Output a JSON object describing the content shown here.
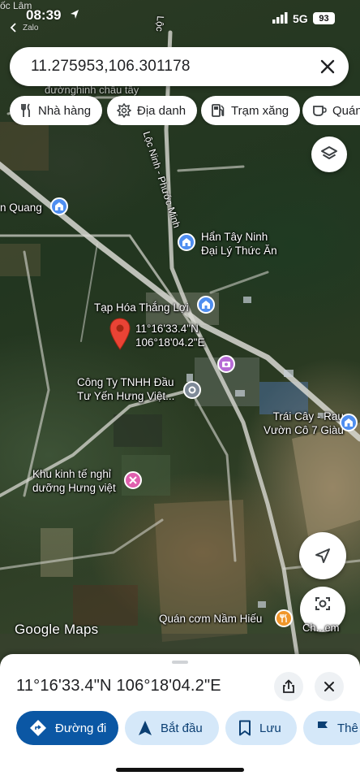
{
  "status_bar": {
    "carrier": "Zalo",
    "time": "08:39",
    "network": "5G",
    "battery": "93",
    "top_left_label": "ốc Lâm"
  },
  "search": {
    "query": "11.275953,106.301178"
  },
  "chips": [
    {
      "label": "Nhà hàng",
      "icon": "restaurant-icon"
    },
    {
      "label": "Địa danh",
      "icon": "landmark-icon"
    },
    {
      "label": "Trạm xăng",
      "icon": "gas-station-icon"
    },
    {
      "label": "Quán",
      "icon": "coffee-icon"
    }
  ],
  "map": {
    "faded_label": "đườnghinh châu tây",
    "road_name": "Lộc Ninh - Phước Minh",
    "road_name_top": "Lộc",
    "places": {
      "quang": "n Quang",
      "han_tay_ninh_1": "Hẩn Tây Ninh",
      "han_tay_ninh_2": "Đại Lý Thức Ăn",
      "tap_hoa": "Tạp Hóa Thắng Lợi",
      "pin_coord_1": "11°16'33.4\"N",
      "pin_coord_2": "106°18'04.2\"E",
      "cong_ty_1": "Công Ty TNHH Đầu",
      "cong_ty_2": "Tư Yến Hưng Việt...",
      "trai_cay_1": "Trái Cây - Rau",
      "trai_cay_2": "Vườn Cô 7 Giàu",
      "khu_kinh_te_1": "Khu kinh tế nghỉ",
      "khu_kinh_te_2": "dưỡng Hưng việt",
      "quan_com": "Quán cơm Nầm Hiếu"
    },
    "branding": "Google Maps",
    "lens_label": "Ch...em"
  },
  "sheet": {
    "title": "11°16'33.4\"N 106°18'04.2\"E",
    "actions": [
      {
        "label": "Đường đi",
        "icon": "directions-icon"
      },
      {
        "label": "Bắt đầu",
        "icon": "navigation-arrow-icon"
      },
      {
        "label": "Lưu",
        "icon": "bookmark-icon"
      },
      {
        "label": "Thê",
        "icon": "flag-icon"
      }
    ]
  },
  "colors": {
    "primary": "#0b57a4",
    "secondary_bg": "#d5e8f9",
    "pin_red": "#ea4335"
  }
}
